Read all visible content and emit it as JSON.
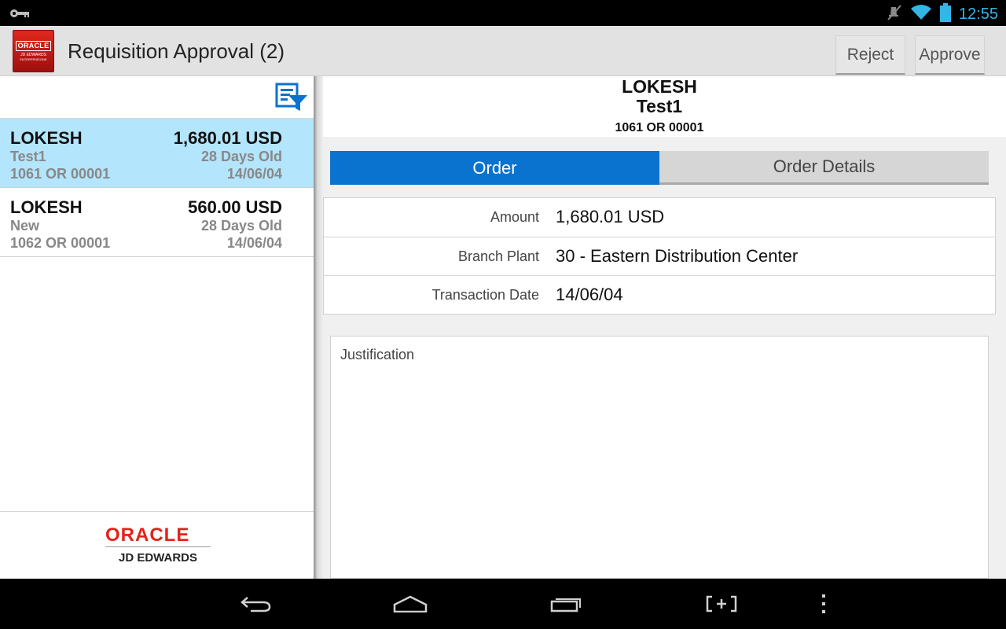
{
  "status_bar": {
    "time": "12:55",
    "icons": [
      "key-icon",
      "mute-icon",
      "wifi-icon",
      "battery-icon"
    ]
  },
  "action_bar": {
    "logo": {
      "line1": "ORACLE",
      "line2": "JD EDWARDS",
      "line3": "ENTERPRISEONE"
    },
    "title": "Requisition Approval (2)",
    "reject_label": "Reject",
    "approve_label": "Approve"
  },
  "list": {
    "items": [
      {
        "name": "LOKESH",
        "amount": "1,680.01 USD",
        "description": "Test1",
        "age": "28 Days Old",
        "order": "1061 OR 00001",
        "date": "14/06/04",
        "selected": true
      },
      {
        "name": "LOKESH",
        "amount": "560.00 USD",
        "description": "New",
        "age": "28 Days Old",
        "order": "1062 OR 00001",
        "date": "14/06/04",
        "selected": false
      }
    ],
    "footer": {
      "oracle": "ORACLE",
      "jde": "JD EDWARDS"
    }
  },
  "detail": {
    "name": "LOKESH",
    "description": "Test1",
    "order": "1061 OR 00001",
    "tabs": [
      {
        "label": "Order",
        "active": true
      },
      {
        "label": "Order Details",
        "active": false
      }
    ],
    "fields": [
      {
        "label": "Amount",
        "value": "1,680.01 USD"
      },
      {
        "label": "Branch Plant",
        "value": "30 - Eastern Distribution Center"
      },
      {
        "label": "Transaction Date",
        "value": "14/06/04"
      }
    ],
    "justification_label": "Justification"
  },
  "colors": {
    "accent": "#0a72cf",
    "selected_row": "#b3e5fc",
    "status_icon": "#33b5e5",
    "oracle_red": "#e2231a"
  },
  "nav_bar": {
    "icons": [
      "back-icon",
      "home-icon",
      "recents-icon",
      "screenshot-icon",
      "menu-icon"
    ]
  }
}
